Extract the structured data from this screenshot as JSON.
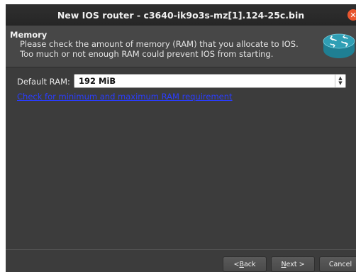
{
  "window": {
    "title": "New IOS router - c3640-ik9o3s-mz[1].124-25c.bin"
  },
  "header": {
    "title": "Memory",
    "description": "Please check the amount of memory (RAM) that you allocate to IOS. Too much or not enough RAM could prevent IOS from starting."
  },
  "form": {
    "ram_label": "Default RAM:",
    "ram_value": "192 MiB",
    "requirement_link": "Check for minimum and maximum RAM requirement"
  },
  "footer": {
    "back_lead": "< ",
    "back_key": "B",
    "back_rest": "ack",
    "next_key": "N",
    "next_rest": "ext >",
    "cancel_label": "Cancel"
  },
  "colors": {
    "close_button": "#e9562f",
    "link": "#2a3cff",
    "router_icon": "#2f9fb5"
  },
  "icons": {
    "close": "close-icon",
    "router": "router-icon",
    "spin": "spin-arrows-icon"
  }
}
